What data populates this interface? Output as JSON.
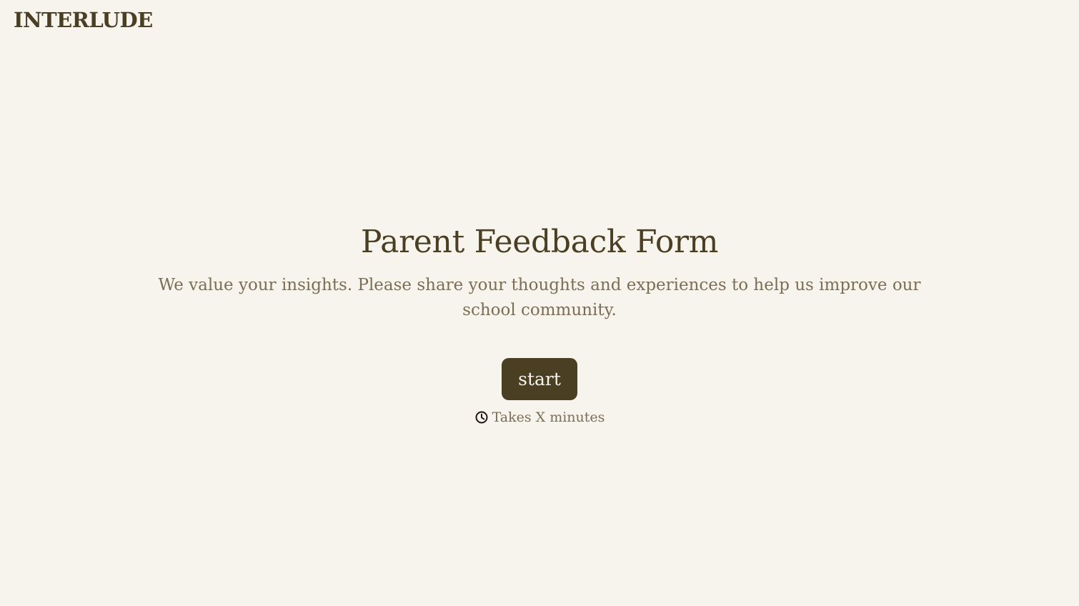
{
  "brand": {
    "name": "INTERLUDE"
  },
  "form": {
    "title": "Parent Feedback Form",
    "description": "We value your insights. Please share your thoughts and experiences to help us improve our school community.",
    "start_label": "start",
    "duration_text": "Takes X minutes",
    "duration_icon": "clock-icon"
  },
  "colors": {
    "background": "#f7f3ed",
    "primary": "#4a3f23",
    "muted_text": "#7b6e55"
  }
}
